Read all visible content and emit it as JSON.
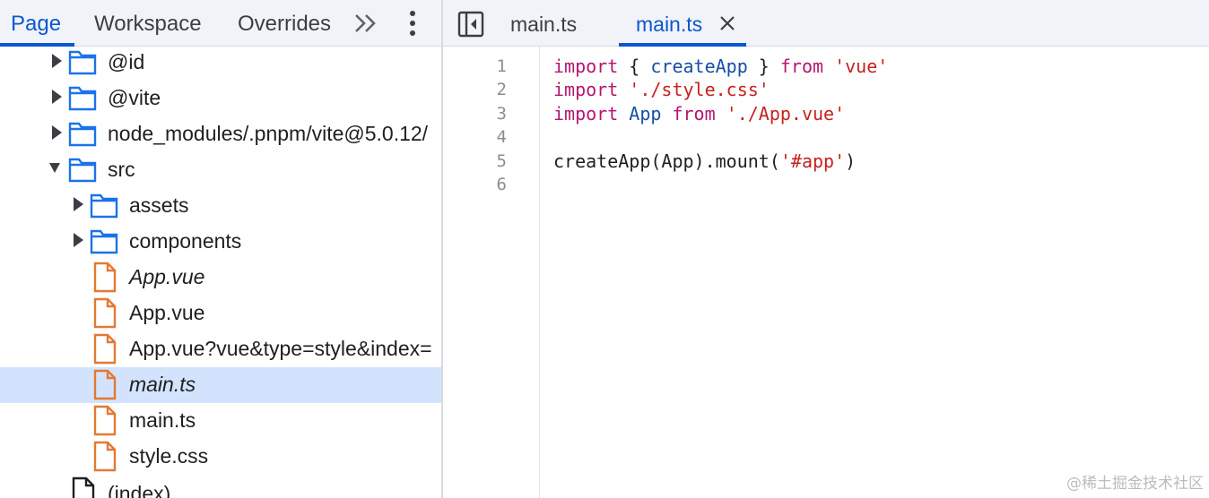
{
  "navigator": {
    "tabs": [
      {
        "label": "Page",
        "active": true
      },
      {
        "label": "Workspace",
        "active": false
      },
      {
        "label": "Overrides",
        "active": false
      }
    ],
    "more_tabs_icon": "double-chevron-right-icon",
    "menu_icon": "vertical-ellipsis-icon"
  },
  "tree": [
    {
      "label": "@id",
      "kind": "folder",
      "expanded": false,
      "depth": 0
    },
    {
      "label": "@vite",
      "kind": "folder",
      "expanded": false,
      "depth": 0
    },
    {
      "label": "node_modules/.pnpm/vite@5.0.12/",
      "kind": "folder",
      "expanded": false,
      "depth": 0
    },
    {
      "label": "src",
      "kind": "folder",
      "expanded": true,
      "depth": 0
    },
    {
      "label": "assets",
      "kind": "folder",
      "expanded": false,
      "depth": 1
    },
    {
      "label": "components",
      "kind": "folder",
      "expanded": false,
      "depth": 1
    },
    {
      "label": "App.vue",
      "kind": "file",
      "italic": true,
      "depth": 1
    },
    {
      "label": "App.vue",
      "kind": "file",
      "italic": false,
      "depth": 1
    },
    {
      "label": "App.vue?vue&type=style&index=",
      "kind": "file",
      "italic": false,
      "depth": 1
    },
    {
      "label": "main.ts",
      "kind": "file",
      "italic": true,
      "selected": true,
      "depth": 1
    },
    {
      "label": "main.ts",
      "kind": "file",
      "italic": false,
      "depth": 1
    },
    {
      "label": "style.css",
      "kind": "file",
      "italic": false,
      "depth": 1
    },
    {
      "label": "(index)",
      "kind": "document",
      "italic": false,
      "depth": 0
    }
  ],
  "editor": {
    "toggle_icon": "toggle-navigator-icon",
    "tabs": [
      {
        "label": "main.ts",
        "active": false
      },
      {
        "label": "main.ts",
        "active": true,
        "closable": true
      }
    ],
    "close_icon": "close-icon",
    "line_numbers": [
      "1",
      "2",
      "3",
      "4",
      "5",
      "6"
    ],
    "code": [
      [
        {
          "t": "import",
          "c": "kw"
        },
        {
          "t": " { ",
          "c": ""
        },
        {
          "t": "createApp",
          "c": "id"
        },
        {
          "t": " } ",
          "c": ""
        },
        {
          "t": "from",
          "c": "kw"
        },
        {
          "t": " ",
          "c": ""
        },
        {
          "t": "'vue'",
          "c": "str"
        }
      ],
      [
        {
          "t": "import",
          "c": "kw"
        },
        {
          "t": " ",
          "c": ""
        },
        {
          "t": "'./style.css'",
          "c": "str"
        }
      ],
      [
        {
          "t": "import",
          "c": "kw"
        },
        {
          "t": " ",
          "c": ""
        },
        {
          "t": "App",
          "c": "id"
        },
        {
          "t": " ",
          "c": ""
        },
        {
          "t": "from",
          "c": "kw"
        },
        {
          "t": " ",
          "c": ""
        },
        {
          "t": "'./App.vue'",
          "c": "str"
        }
      ],
      [],
      [
        {
          "t": "createApp(App).mount(",
          "c": ""
        },
        {
          "t": "'#app'",
          "c": "str"
        },
        {
          "t": ")",
          "c": ""
        }
      ],
      []
    ]
  },
  "watermark": "@稀土掘金技术社区",
  "colors": {
    "accent": "#0b57d0",
    "selected_row": "#d3e3fd",
    "folder_icon": "#1a73e8",
    "file_icon": "#e37933",
    "keyword": "#b5166e",
    "identifier": "#174ea6",
    "string": "#c5221f"
  }
}
